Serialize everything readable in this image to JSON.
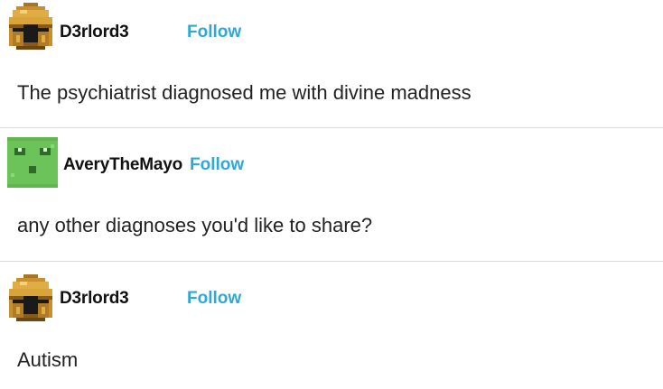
{
  "posts": [
    {
      "username": "D3rlord3",
      "follow_label": "Follow",
      "text": "The psychiatrist diagnosed me with divine madness",
      "avatar_icon": "golden-helmet-avatar"
    },
    {
      "username": "AveryTheMayo",
      "follow_label": "Follow",
      "text": "any other diagnoses you'd like to share?",
      "avatar_icon": "green-slime-avatar"
    },
    {
      "username": "D3rlord3",
      "follow_label": "Follow",
      "text": "Autism",
      "avatar_icon": "golden-helmet-avatar"
    }
  ],
  "colors": {
    "follow": "#2ea9d6",
    "divider": "#dcdcdc",
    "helmet_gold": "#d9a53a",
    "slime_green": "#6cc35a"
  }
}
